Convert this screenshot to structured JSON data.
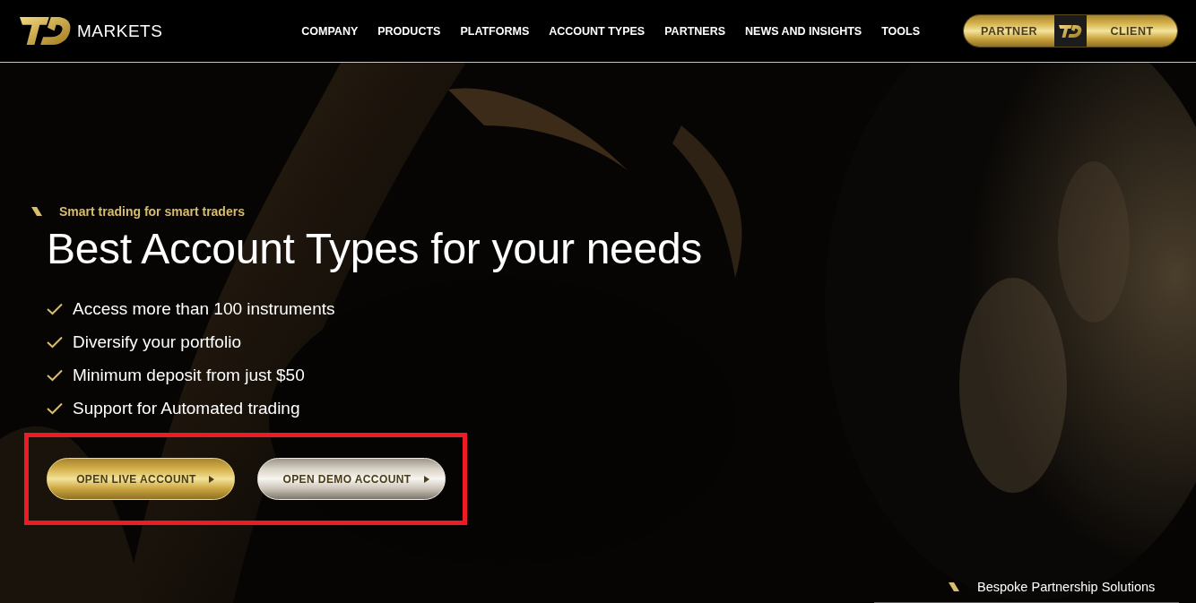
{
  "header": {
    "brand": "MARKETS",
    "nav": [
      {
        "label": "COMPANY"
      },
      {
        "label": "PRODUCTS"
      },
      {
        "label": "PLATFORMS"
      },
      {
        "label": "ACCOUNT TYPES"
      },
      {
        "label": "PARTNERS"
      },
      {
        "label": "NEWS AND INSIGHTS"
      },
      {
        "label": "TOOLS"
      }
    ],
    "portal": {
      "left": "PARTNER",
      "right": "CLIENT"
    }
  },
  "hero": {
    "kind": "picture",
    "tagline": "Smart trading for smart traders",
    "title": "Best Account Types for your needs",
    "features": [
      "Access more than 100 instruments",
      "Diversify your portfolio",
      "Minimum deposit from just $50",
      "Support for Automated trading"
    ],
    "actions": {
      "highlighted": true,
      "buttons": [
        {
          "label": "OPEN LIVE ACCOUNT",
          "kind": "gold"
        },
        {
          "label": "OPEN DEMO ACCOUNT",
          "kind": "silver"
        }
      ]
    },
    "side_link": "Bespoke Partnership Solutions"
  }
}
